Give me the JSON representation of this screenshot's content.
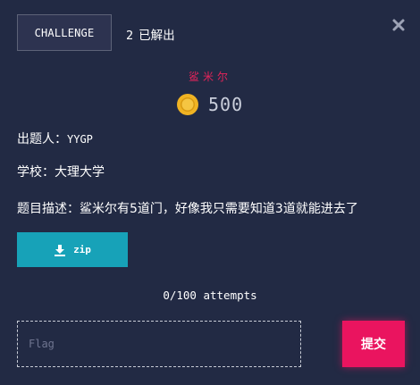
{
  "header": {
    "tab_label": "CHALLENGE",
    "solves_count": "2",
    "solves_label": "已解出"
  },
  "challenge": {
    "name": "鲨米尔",
    "points": "500",
    "author_label": "出题人：",
    "author": "YYGP",
    "school_label": "学校：",
    "school": "大理大学",
    "description_label": "题目描述：",
    "description": "鲨米尔有5道门，好像我只需要知道3道就能进去了"
  },
  "attachment": {
    "label": "zip"
  },
  "attempts": "0/100 attempts",
  "form": {
    "flag_placeholder": "Flag",
    "flag_value": "",
    "submit_label": "提交"
  },
  "colors": {
    "background": "#222a44",
    "accent_pink": "#ea145f",
    "download_teal": "#17a2b8",
    "coin_gold": "#f0b323"
  },
  "icons": {
    "close": "close-icon",
    "coin": "coin-icon",
    "download": "download-icon"
  }
}
